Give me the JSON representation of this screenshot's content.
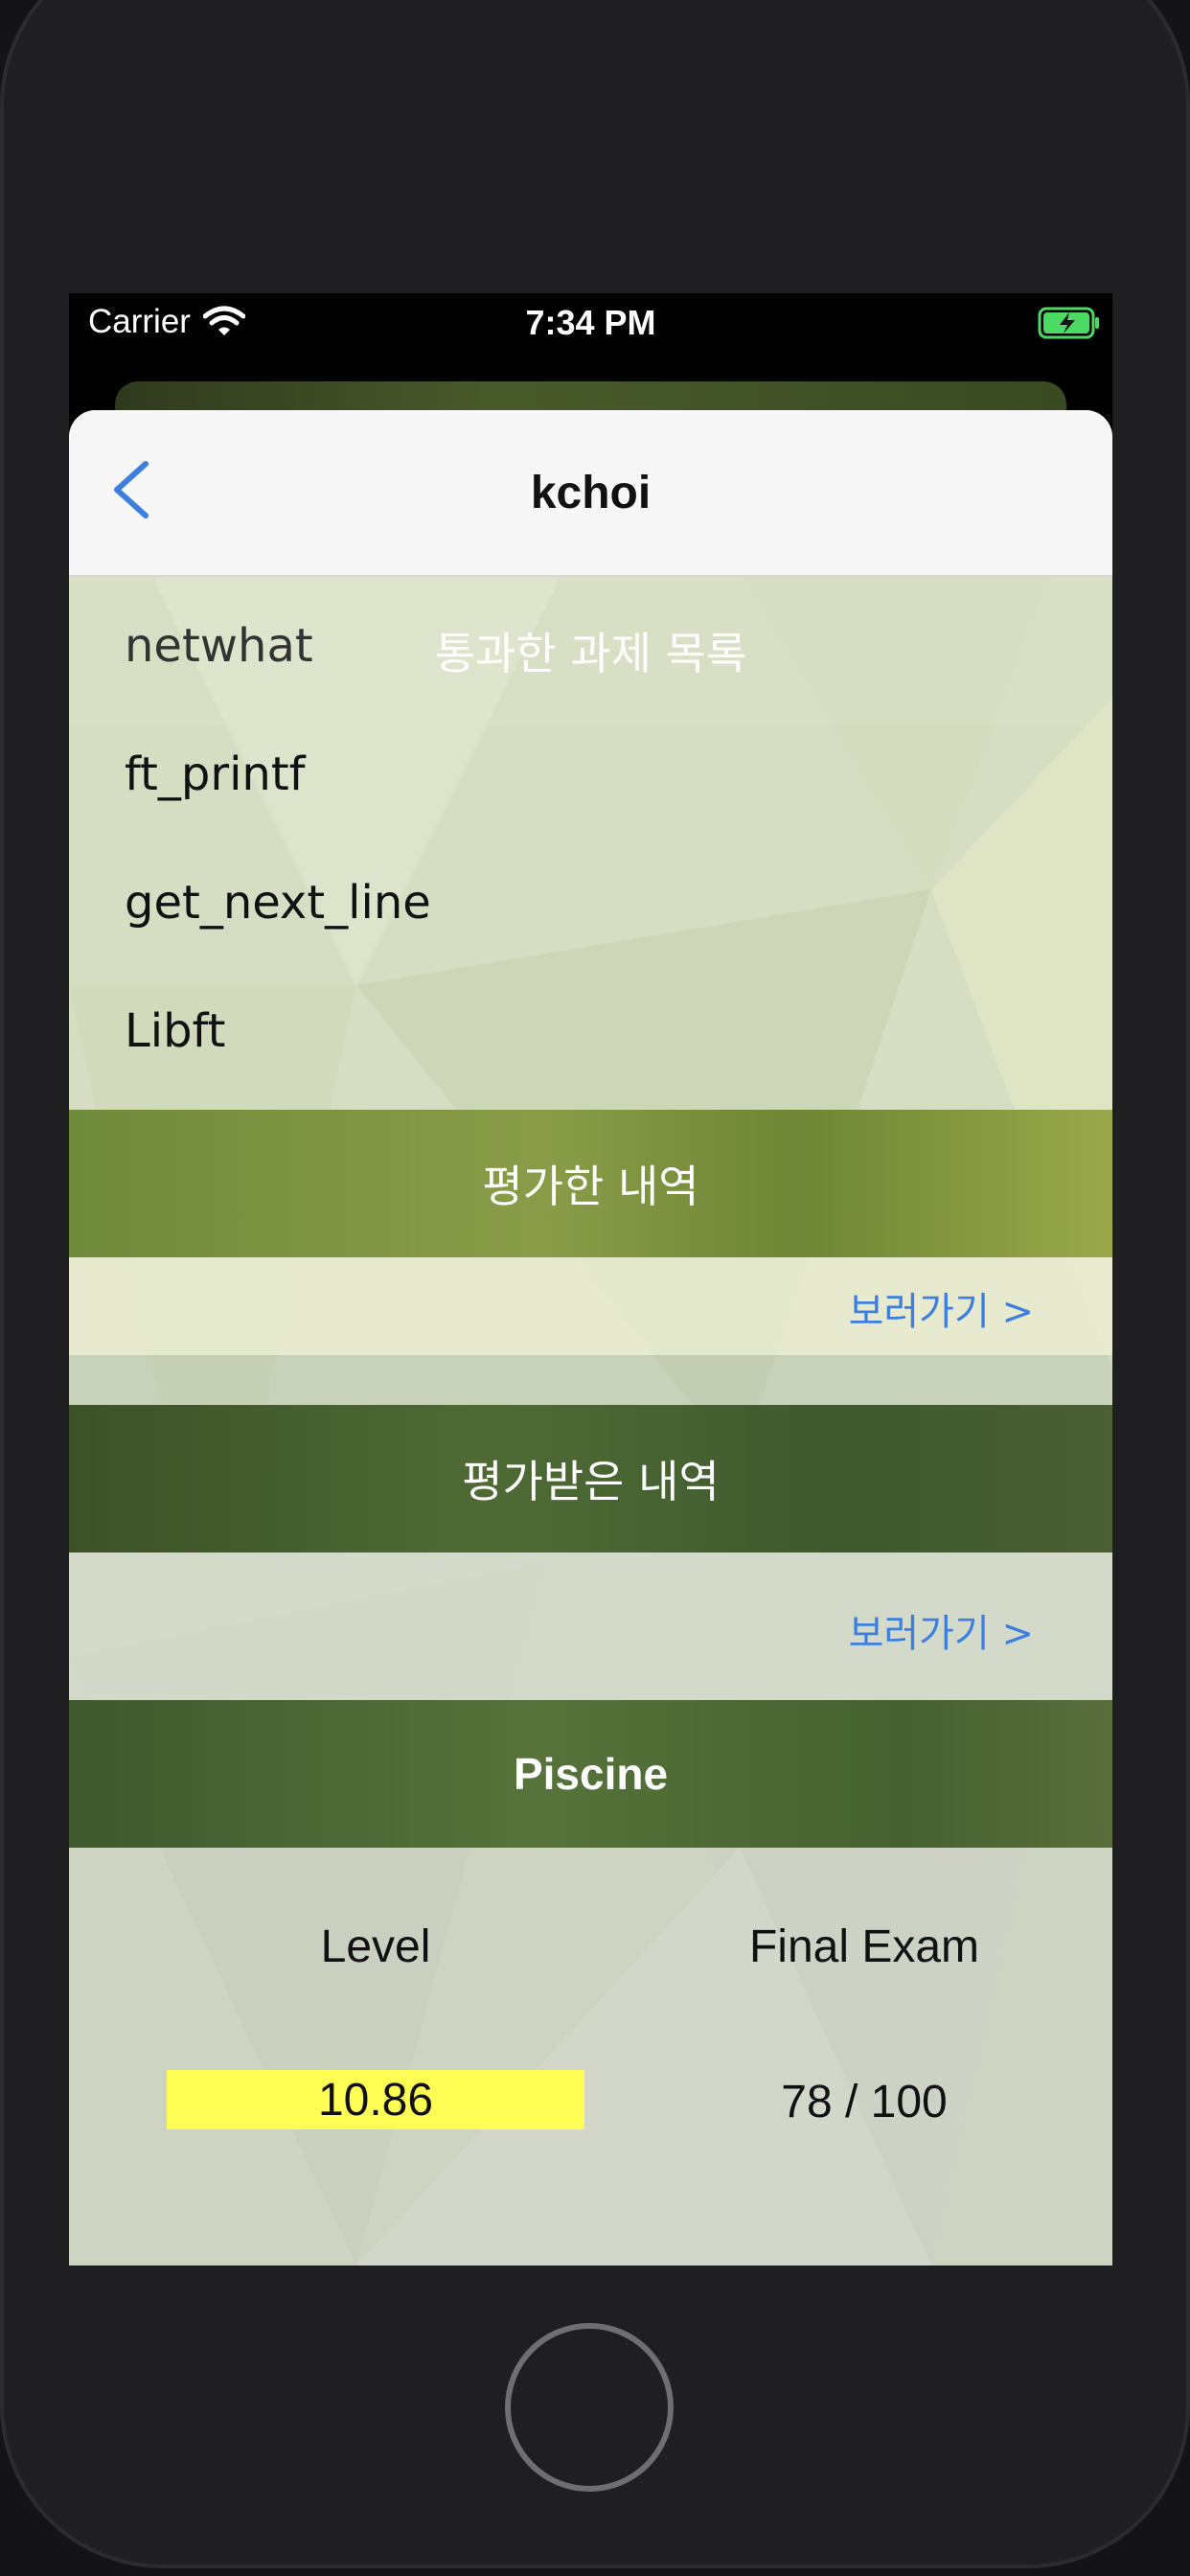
{
  "status_bar": {
    "carrier": "Carrier",
    "time": "7:34 PM"
  },
  "navbar": {
    "back_icon": "chevron-left-icon",
    "title": "kchoi"
  },
  "passed_projects": {
    "header": "통과한 과제 목록",
    "items": [
      "netwhat",
      "ft_printf",
      "get_next_line",
      "Libft"
    ]
  },
  "evaluations_given": {
    "header": "평가한 내역",
    "link": "보러가기 >"
  },
  "evaluations_received": {
    "header": "평가받은 내역",
    "link": "보러가기 >"
  },
  "piscine": {
    "header": "Piscine",
    "level_label": "Level",
    "final_exam_label": "Final Exam",
    "level_value": "10.86",
    "final_exam_value": "78 / 100"
  },
  "colors": {
    "accent": "#3d7fe0",
    "level_highlight": "#fefe54",
    "battery": "#4cd964"
  }
}
